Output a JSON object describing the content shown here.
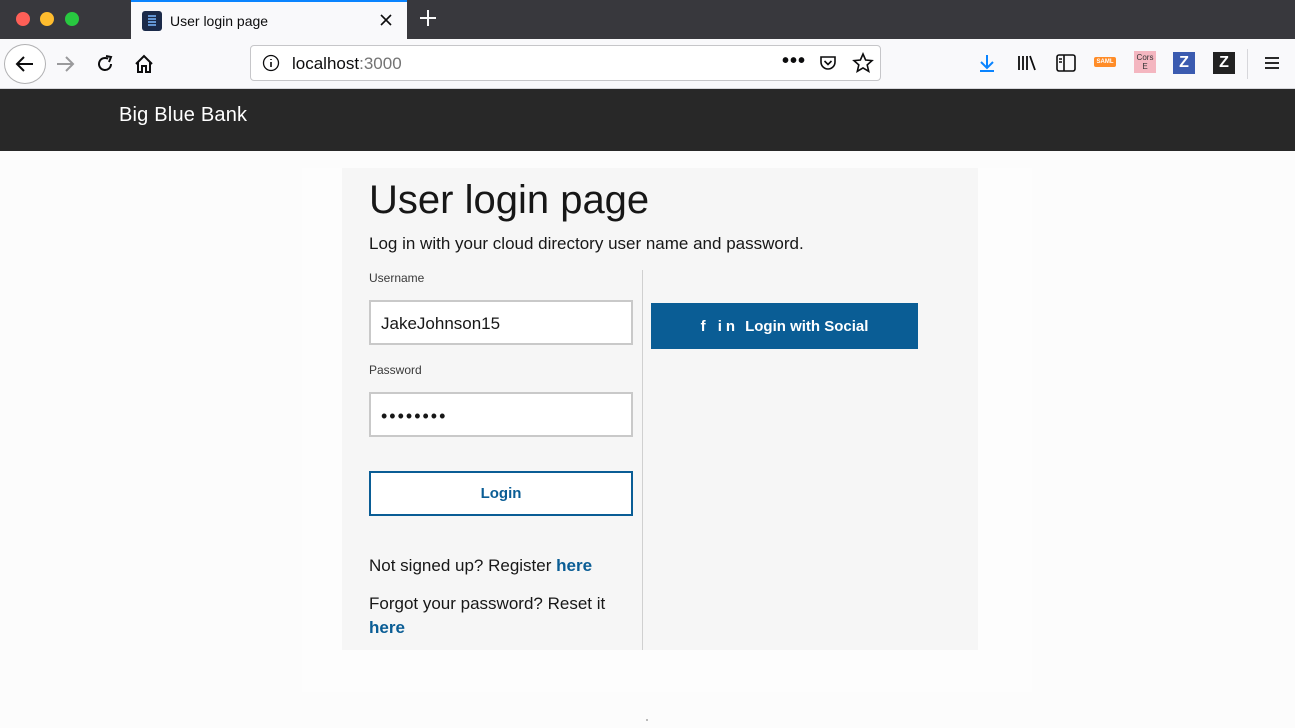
{
  "browser": {
    "tab_title": "User login page",
    "url_host": "localhost",
    "url_port": ":3000",
    "url_more": "•••",
    "ext_saml": "SAML",
    "ext_cors_line1": "Cors",
    "ext_cors_line2": "E",
    "ext_z1": "Z",
    "ext_z2": "Z"
  },
  "app": {
    "brand": "Big Blue Bank"
  },
  "login": {
    "heading": "User login page",
    "subtitle": "Log in with your cloud directory user name and password.",
    "username_label": "Username",
    "username_value": "JakeJohnson15",
    "password_label": "Password",
    "password_value": "••••••••",
    "login_button": "Login",
    "social_icons": "f in",
    "social_button": "Login with Social",
    "register_prefix": "Not signed up? Register ",
    "register_link": "here",
    "forgot_prefix": "Forgot your password? Reset it",
    "forgot_link": "here"
  },
  "colors": {
    "accent": "#0a5d95",
    "header_bg": "#282828",
    "tab_accent": "#0a84ff"
  }
}
